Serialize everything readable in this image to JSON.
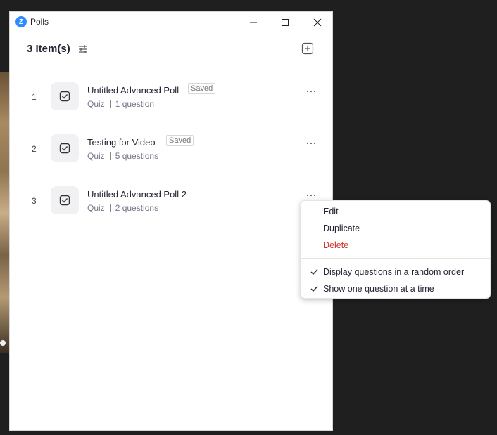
{
  "window": {
    "title": "Polls",
    "logo_letter": "Z"
  },
  "header": {
    "items_count": "3 Item(s)"
  },
  "polls": [
    {
      "index": "1",
      "title": "Untitled Advanced Poll",
      "badge": "Saved",
      "type": "Quiz",
      "questions": "1 question"
    },
    {
      "index": "2",
      "title": "Testing for Video",
      "badge": "Saved",
      "type": "Quiz",
      "questions": "5 questions"
    },
    {
      "index": "3",
      "title": "Untitled Advanced Poll 2",
      "badge": "",
      "type": "Quiz",
      "questions": "2 questions"
    }
  ],
  "context_menu": {
    "edit": "Edit",
    "duplicate": "Duplicate",
    "delete": "Delete",
    "random_order": "Display questions in a random order",
    "one_at_a_time": "Show one question at a time"
  },
  "colors": {
    "accent": "#2d8cff",
    "danger": "#d0342c"
  }
}
